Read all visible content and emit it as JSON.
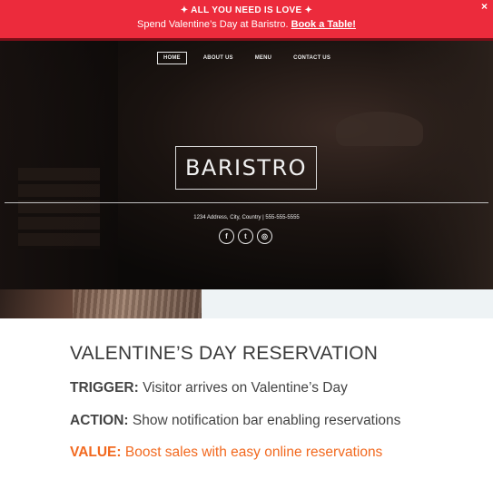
{
  "notification": {
    "headline": "✦ ALL YOU NEED IS LOVE ✦",
    "message": "Spend Valentine’s Day at Baristro.",
    "cta": "Book a Table!",
    "close_glyph": "×",
    "bg_color": "#ec2b3c"
  },
  "nav": {
    "items": [
      "HOME",
      "ABOUT US",
      "MENU",
      "CONTACT US"
    ],
    "active": "HOME"
  },
  "hero": {
    "logo": "BARISTRO",
    "address": "1234 Address, City, Country | 555-555-5555",
    "socials": [
      {
        "icon": "facebook-icon",
        "glyph": "f"
      },
      {
        "icon": "twitter-icon",
        "glyph": "t"
      },
      {
        "icon": "instagram-icon",
        "glyph": "◎"
      }
    ]
  },
  "content": {
    "title": "VALENTINE’S DAY RESERVATION",
    "trigger_label": "TRIGGER:",
    "trigger_text": "Visitor arrives on Valentine’s Day",
    "action_label": "ACTION:",
    "action_text": "Show notification bar enabling reservations",
    "value_label": "VALUE:",
    "value_text": "Boost sales with easy online reservations",
    "value_color": "#f2691f"
  }
}
